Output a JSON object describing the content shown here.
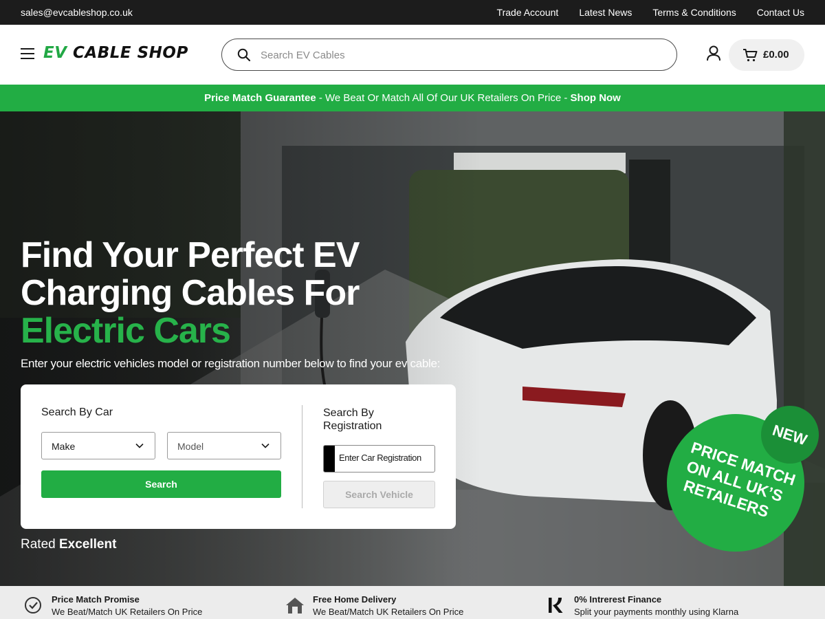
{
  "topbar": {
    "email": "sales@evcableshop.co.uk",
    "links": [
      "Trade Account",
      "Latest News",
      "Terms & Conditions",
      "Contact Us"
    ]
  },
  "header": {
    "logo_ev": "EV",
    "logo_rest": " CABLE SHOP",
    "search_placeholder": "Search EV Cables",
    "cart_total": "£0.00"
  },
  "promo": {
    "bold_start": "Price Match Guarantee",
    "middle": " - We Beat Or Match All Of Our UK Retailers On Price - ",
    "bold_end": "Shop Now"
  },
  "hero": {
    "title_line1": "Find Your Perfect EV",
    "title_line2": "Charging Cables For",
    "title_line3": "Electric Cars",
    "subtitle": "Enter your electric vehicles model or registration number below to find your ev cable:",
    "rated_prefix": "Rated ",
    "rated_value": "Excellent"
  },
  "finder": {
    "car_heading": "Search By Car",
    "make_label": "Make",
    "model_label": "Model",
    "search_button": "Search",
    "reg_heading": "Search By Registration",
    "reg_placeholder": "Enter Car Registration",
    "vehicle_button": "Search Vehicle"
  },
  "badge": {
    "line1": "PRICE MATCH",
    "line2": "ON ALL UK’S",
    "line3": "RETAILERS",
    "new_label": "NEW"
  },
  "features": [
    {
      "icon": "check-circle-icon",
      "title": "Price Match Promise",
      "subtitle": "We Beat/Match UK Retailers On Price"
    },
    {
      "icon": "home-icon",
      "title": "Free Home Delivery",
      "subtitle": "We Beat/Match UK Retailers On Price"
    },
    {
      "icon": "klarna-icon",
      "title": "0% Intrerest Finance",
      "subtitle": "Split your payments monthly using Klarna"
    }
  ],
  "colors": {
    "brand_green": "#22ad44",
    "topbar_bg": "#1c1c1c"
  }
}
